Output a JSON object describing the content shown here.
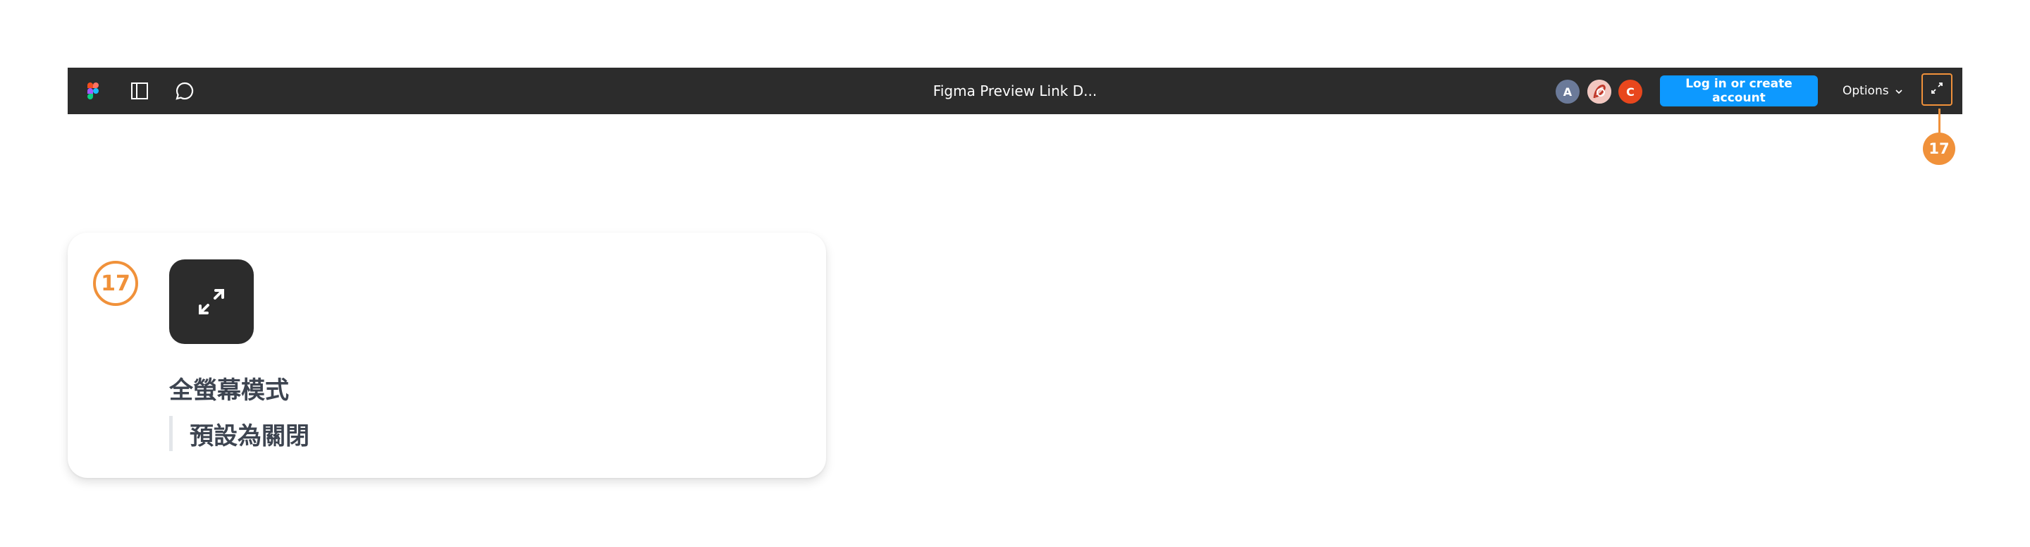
{
  "toolbar": {
    "title": "Figma Preview Link D...",
    "icons": {
      "logo": "figma-logo",
      "panel": "sidebar-panel-icon",
      "comment": "comment-icon",
      "fullscreen": "expand-icon"
    },
    "avatars": [
      {
        "initial": "A",
        "color": "#6b7a99"
      },
      {
        "initial": "",
        "color": "#e8e8e8"
      },
      {
        "initial": "C",
        "color": "#e8471d"
      }
    ],
    "login_label": "Log in or create account",
    "options_label": "Options",
    "accent": "#0d99ff",
    "background": "#2c2c2c"
  },
  "callout": {
    "number": "17",
    "color": "#f0913a"
  },
  "card": {
    "number": "17",
    "title": "全螢幕模式",
    "subtitle": "預設為關閉"
  }
}
